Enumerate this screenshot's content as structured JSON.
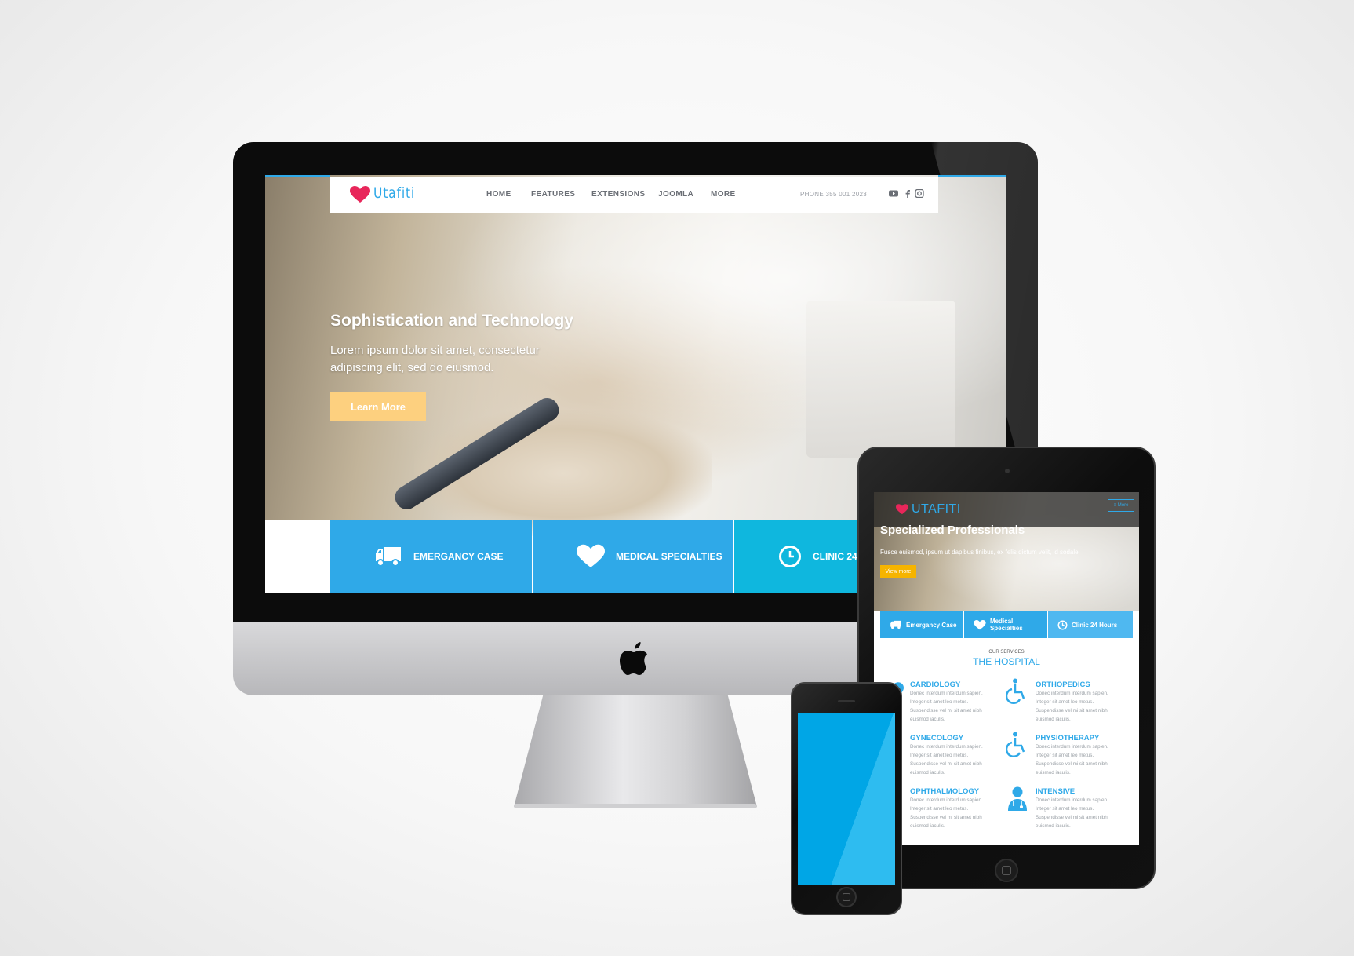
{
  "desktop": {
    "brand": "Utafiti",
    "nav": [
      "HOME",
      "FEATURES",
      "EXTENSIONS",
      "JOOMLA",
      "MORE"
    ],
    "phone": "PHONE 355 001 2023",
    "hero": {
      "title": "Sophistication and Technology",
      "subtitle": "Lorem ipsum dolor sit amet, consectetur adipiscing elit, sed do eiusmod.",
      "button": "Learn More"
    },
    "features": [
      "EMERGANCY CASE",
      "MEDICAL SPECIALTIES",
      "CLINIC 24"
    ],
    "social_icons": [
      "youtube-icon",
      "facebook-icon",
      "instagram-icon"
    ]
  },
  "tablet": {
    "brand": "UTAFITI",
    "menu": "≡ More",
    "hero": {
      "title": "Specialized Professionals",
      "subtitle": "Fusce euismod, ipsum ut dapibus finibus, ex felis dictum velit, id sodale",
      "button": "View more"
    },
    "features": [
      "Emergancy Case",
      "Medical Specialties",
      "Clinic 24 Hours"
    ],
    "eyebrow": "OUR SERVICES",
    "section": "THE HOSPITAL",
    "services": [
      {
        "title": "CARDIOLOGY",
        "icon": "heart-icon"
      },
      {
        "title": "ORTHOPEDICS",
        "icon": "wheelchair-icon"
      },
      {
        "title": "GYNECOLOGY",
        "icon": "heart-icon"
      },
      {
        "title": "PHYSIOTHERAPY",
        "icon": "wheelchair-icon"
      },
      {
        "title": "OPHTHALMOLOGY",
        "icon": "eye-icon"
      },
      {
        "title": "INTENSIVE",
        "icon": "doctor-icon"
      }
    ],
    "service_text": "Donec interdum interdum sapien. Integer sit amet leo metus. Suspendisse vel mi sit amet nibh euismod iaculis."
  },
  "colors": {
    "accent": "#2fa9e8",
    "accent_alt": "#0fb7de",
    "button": "#fdd07f",
    "heart": "#e8265a",
    "tablet_button": "#f6b400"
  }
}
